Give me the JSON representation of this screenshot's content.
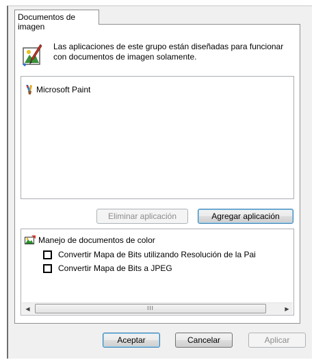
{
  "tab": {
    "label": "Documentos de imagen"
  },
  "description": "Las aplicaciones de este grupo están diseñadas para funcionar con documentos de imagen solamente.",
  "applications": [
    {
      "label": "Microsoft Paint",
      "icon": "paint-brush-icon"
    }
  ],
  "app_buttons": {
    "remove": "Eliminar aplicación",
    "add": "Agregar aplicación"
  },
  "options": {
    "group_label": "Manejo de documentos de color",
    "group_icon": "color-document-icon",
    "items": [
      {
        "label": "Convertir Mapa de Bits utilizando Resolución de la Pai",
        "checked": false
      },
      {
        "label": "Convertir Mapa de Bits a JPEG",
        "checked": false
      }
    ]
  },
  "scrollbar": {
    "left_arrow": "◀",
    "right_arrow": "▶",
    "grip": "III"
  },
  "footer": {
    "ok": "Aceptar",
    "cancel": "Cancelar",
    "apply": "Aplicar"
  }
}
